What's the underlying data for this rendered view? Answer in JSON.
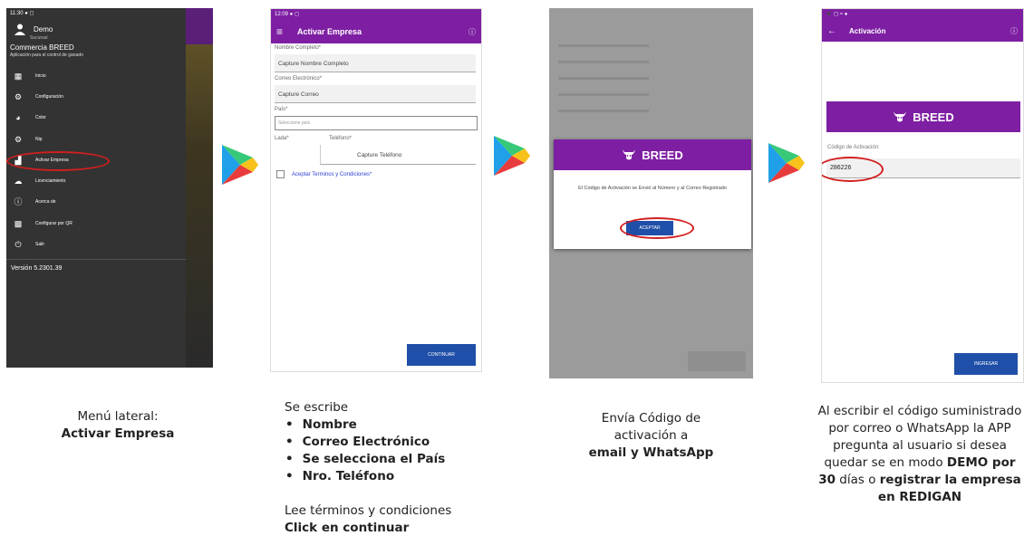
{
  "phone1": {
    "status_time": "11:30",
    "user_name": "Demo",
    "user_sub": "Sucursal",
    "app_name": "Commercia BREED",
    "app_sub": "Aplicación para el control de ganado",
    "menu": [
      {
        "icon": "grid-icon",
        "label": "Inicio"
      },
      {
        "icon": "gear-icon",
        "label": "Configuración"
      },
      {
        "icon": "palette-icon",
        "label": "Color"
      },
      {
        "icon": "gear-icon",
        "label": "Nip"
      },
      {
        "icon": "factory-icon",
        "label": "Activar Empresa"
      },
      {
        "icon": "cloud-icon",
        "label": "Licenciamiento"
      },
      {
        "icon": "info-icon",
        "label": "Acerca de"
      },
      {
        "icon": "qr-icon",
        "label": "Configurar por QR"
      },
      {
        "icon": "power-icon",
        "label": "Salir"
      }
    ],
    "version": "Versión 5.2301.39"
  },
  "phone2": {
    "status_time": "12:09",
    "title": "Activar Empresa",
    "name_label": "Nombre Completo*",
    "name_placeholder": "Capture Nombre Completo",
    "email_label": "Correo Electrónico*",
    "email_placeholder": "Capture Correo",
    "country_label": "País*",
    "country_placeholder": "Seleccione país",
    "lada_label": "Lada*",
    "phone_label": "Teléfono*",
    "phone_placeholder": "Capture Teléfono",
    "terms": "Aceptar Terminos y Condiciones*",
    "continue": "CONTINUAR"
  },
  "phone3": {
    "brand": "BREED",
    "message": "El Código de Activación se Envió al Número y al Correo Registrado",
    "accept": "ACEPTAR"
  },
  "phone4": {
    "title": "Activación",
    "brand": "BREED",
    "code_label": "Código de Activación:",
    "code_value": "286226",
    "submit": "INGRESAR"
  },
  "captions": {
    "c1_line1": "Menú lateral:",
    "c1_line2": "Activar Empresa",
    "c2_intro": "Se escribe",
    "c2_items": [
      "Nombre",
      "Correo Electrónico",
      "Se selecciona el País",
      "Nro. Teléfono"
    ],
    "c2_line1": "Lee términos y condiciones",
    "c2_line2": "Click en continuar",
    "c3_line1": "Envía Código de",
    "c3_line2": "activación a",
    "c3_line3": "email y WhatsApp",
    "c4_plain1": "Al escribir el código suministrado por correo o WhatsApp la APP pregunta al usuario si desea quedar se en modo ",
    "c4_bold1": "DEMO por 30",
    "c4_plain2": " días o ",
    "c4_bold2": "registrar la empresa en REDIGAN"
  },
  "colors": {
    "purple": "#7e1fa3",
    "button_blue": "#1f4fa8",
    "highlight_red": "#d21f1f"
  }
}
